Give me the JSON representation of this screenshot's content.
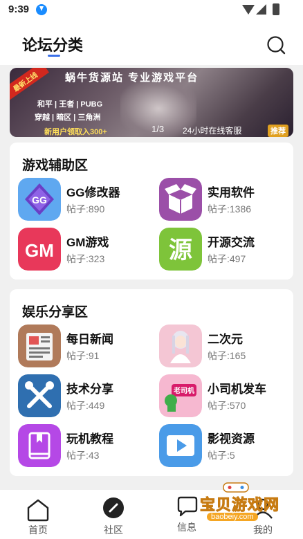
{
  "status_bar": {
    "time": "9:39"
  },
  "header": {
    "title": "论坛分类"
  },
  "banner": {
    "tag": "最新上线",
    "headline": "蜗牛货源站 专业游戏平台",
    "line2": "和平 | 王者 | PUBG",
    "line3": "穿越 | 暗区 | 三角洲",
    "line4": "新用户领取入300+",
    "service": "24小时在线客服",
    "badge": "推荐",
    "pager": "1/3"
  },
  "sections": [
    {
      "title": "游戏辅助区",
      "items": [
        {
          "name": "GG修改器",
          "count": "帖子:890"
        },
        {
          "name": "实用软件",
          "count": "帖子:1386"
        },
        {
          "name": "GM游戏",
          "count": "帖子:323"
        },
        {
          "name": "开源交流",
          "count": "帖子:497"
        }
      ]
    },
    {
      "title": "娱乐分享区",
      "items": [
        {
          "name": "每日新闻",
          "count": "帖子:91"
        },
        {
          "name": "二次元",
          "count": "帖子:165"
        },
        {
          "name": "技术分享",
          "count": "帖子:449"
        },
        {
          "name": "小司机发车",
          "count": "帖子:570"
        },
        {
          "name": "玩机教程",
          "count": "帖子:43"
        },
        {
          "name": "影视资源",
          "count": "帖子:5"
        }
      ]
    }
  ],
  "icons": {
    "gm_text": "GM",
    "kaiyuan_text": "源",
    "driver_text": "老司机"
  },
  "nav": [
    {
      "label": "首页"
    },
    {
      "label": "社区"
    },
    {
      "label": "信息"
    },
    {
      "label": "我的"
    }
  ],
  "watermark": {
    "title": "宝贝游戏网",
    "url": "baobeiy.com"
  },
  "colors": {
    "accent": "#3a6fe8",
    "background": "#f0f0f0"
  }
}
